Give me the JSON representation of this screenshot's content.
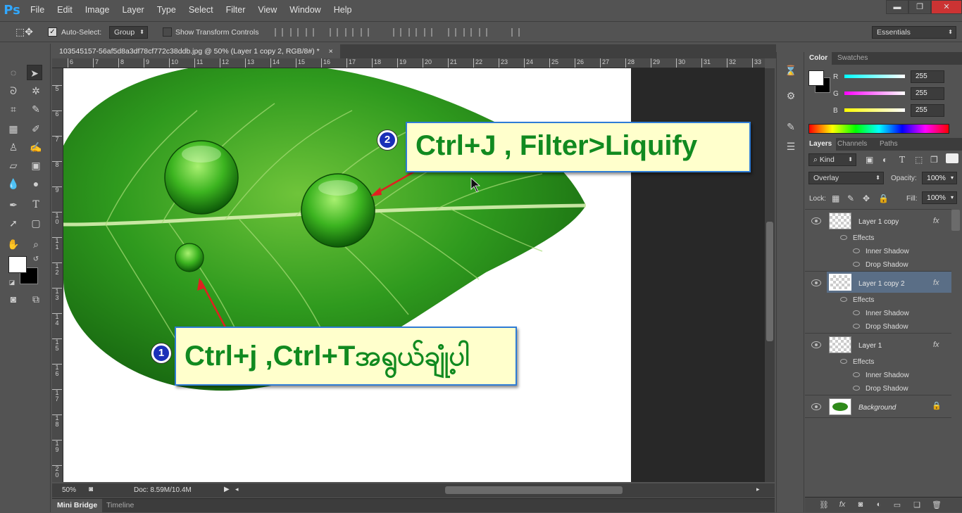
{
  "app": {
    "logo": "Ps"
  },
  "menu": [
    "File",
    "Edit",
    "Image",
    "Layer",
    "Type",
    "Select",
    "Filter",
    "View",
    "Window",
    "Help"
  ],
  "window_controls": {
    "minimize": "▬",
    "restore": "❐",
    "close": "✕"
  },
  "options": {
    "auto_select_label": "Auto-Select:",
    "auto_select_checked": true,
    "auto_select_value": "Group",
    "transform_label": "Show Transform Controls",
    "transform_checked": false,
    "workspace": "Essentials"
  },
  "document": {
    "tab_title": "103545157-56af5d8a3df78cf772c38ddb.jpg @ 50% (Layer 1 copy 2, RGB/8#) *",
    "close": "×",
    "zoom": "50%",
    "doc_size": "Doc: 8.59M/10.4M"
  },
  "ruler_h": [
    "6",
    "7",
    "8",
    "9",
    "10",
    "11",
    "12",
    "13",
    "14",
    "15",
    "16",
    "17",
    "18",
    "19",
    "20",
    "21",
    "22",
    "23",
    "24",
    "25",
    "26",
    "27",
    "28",
    "29",
    "30",
    "31",
    "32",
    "33"
  ],
  "ruler_v": [
    "5",
    "6",
    "7",
    "8",
    "9",
    "1\n0",
    "1\n1",
    "1\n2",
    "1\n3",
    "1\n4",
    "1\n5",
    "1\n6",
    "1\n7",
    "1\n8",
    "1\n9",
    "2\n0"
  ],
  "bottom_tabs": [
    "Mini Bridge",
    "Timeline"
  ],
  "color_panel": {
    "tabs": [
      "Color",
      "Swatches"
    ],
    "channels": [
      {
        "label": "R",
        "value": "255",
        "gradient": "#00ffff"
      },
      {
        "label": "G",
        "value": "255",
        "gradient": "#ff00ff"
      },
      {
        "label": "B",
        "value": "255",
        "gradient": "#ffff00"
      }
    ]
  },
  "layers_panel": {
    "tabs": [
      "Layers",
      "Channels",
      "Paths"
    ],
    "kind": "Kind",
    "blend_mode": "Overlay",
    "opacity_label": "Opacity:",
    "opacity": "100%",
    "lock_label": "Lock:",
    "fill_label": "Fill:",
    "fill": "100%",
    "layers": [
      {
        "name": "Layer 1 copy",
        "fx": "fx",
        "effects_label": "Effects",
        "effects": [
          "Inner Shadow",
          "Drop Shadow"
        ],
        "selected": false
      },
      {
        "name": "Layer 1 copy 2",
        "fx": "fx",
        "effects_label": "Effects",
        "effects": [
          "Inner Shadow",
          "Drop Shadow"
        ],
        "selected": true
      },
      {
        "name": "Layer 1",
        "fx": "fx",
        "effects_label": "Effects",
        "effects": [
          "Inner Shadow",
          "Drop Shadow"
        ],
        "selected": false
      }
    ],
    "background_name": "Background",
    "bottom_icons": [
      "link-icon",
      "fx-icon",
      "mask-icon",
      "adjustment-icon",
      "folder-icon",
      "new-layer-icon",
      "trash-icon"
    ]
  },
  "callouts": [
    {
      "number": "1",
      "text": "Ctrl+j ,Ctrl+Tအရွယ်ချုံ့ပါ"
    },
    {
      "number": "2",
      "text": "Ctrl+J , Filter>Liquify"
    }
  ],
  "colors": {
    "panel": "#535353",
    "dark": "#3c3c3c",
    "callout_bg": "#ffffcc",
    "callout_border": "#2e7cd6",
    "callout_text": "#118a20",
    "badge": "#1a2fb8",
    "arrow": "#e02020"
  }
}
